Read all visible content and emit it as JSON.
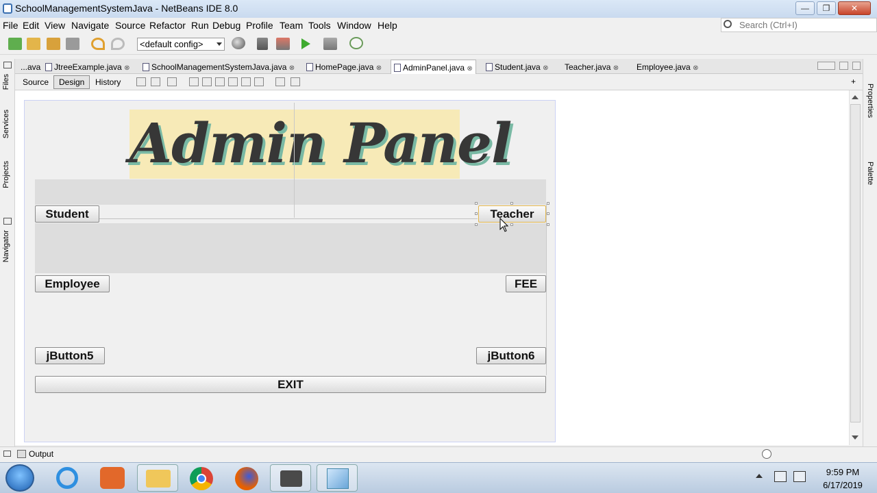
{
  "window": {
    "title": "SchoolManagementSystemJava - NetBeans IDE 8.0",
    "min": "—",
    "max": "❐",
    "close": "✕"
  },
  "menu": [
    "File",
    "Edit",
    "View",
    "Navigate",
    "Source",
    "Refactor",
    "Run",
    "Debug",
    "Profile",
    "Team",
    "Tools",
    "Window",
    "Help"
  ],
  "search": {
    "placeholder": "Search (Ctrl+I)"
  },
  "toolbar": {
    "config": "<default config>"
  },
  "side_left": {
    "files": "Files",
    "services": "Services",
    "projects": "Projects",
    "navigator": "Navigator"
  },
  "side_right": {
    "properties": "Properties",
    "palette": "Palette"
  },
  "tabs": [
    {
      "label": "...ava",
      "active": false
    },
    {
      "label": "JtreeExample.java",
      "active": false
    },
    {
      "label": "SchoolManagementSystemJava.java",
      "active": false
    },
    {
      "label": "HomePage.java",
      "active": false
    },
    {
      "label": "AdminPanel.java",
      "active": true
    },
    {
      "label": "Student.java",
      "active": false
    },
    {
      "label": "Teacher.java",
      "active": false
    },
    {
      "label": "Employee.java",
      "active": false
    }
  ],
  "tab_close": "⊗",
  "modes": {
    "source": "Source",
    "design": "Design",
    "history": "History"
  },
  "form": {
    "banner": "Admin Panel",
    "btn_student": "Student",
    "btn_teacher": "Teacher",
    "btn_employee": "Employee",
    "btn_fee": "FEE",
    "btn_jbutton5": "jButton5",
    "btn_jbutton6": "jButton6",
    "btn_exit": "EXIT"
  },
  "output": {
    "label": "Output"
  },
  "clock": {
    "time": "9:59 PM",
    "date": "6/17/2019"
  },
  "colors": {
    "accent_selection": "#e3b64a",
    "banner_bg": "#f7eab7",
    "banner_shadow": "#79b9a4"
  }
}
